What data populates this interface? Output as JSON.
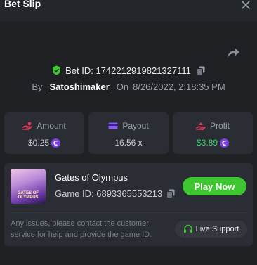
{
  "header": {
    "title": "Bet Slip",
    "close_icon": "close-icon"
  },
  "bet": {
    "id_label": "Bet ID: 1742212919821327111",
    "by_label": "By",
    "username": "Satoshimaker",
    "on_label": "On",
    "datetime": "8/26/2022, 2:18:35 PM"
  },
  "stats": {
    "amount": {
      "label": "Amount",
      "value": "$0.25",
      "icon": "amount-icon"
    },
    "payout": {
      "label": "Payout",
      "value": "16.56 x",
      "icon": "payout-icon"
    },
    "profit": {
      "label": "Profit",
      "value": "$3.89",
      "icon": "profit-icon"
    }
  },
  "game": {
    "thumb_text_line1": "GATES OF",
    "thumb_text_line2": "OLYMPUS",
    "name": "Gates of Olympus",
    "id_label": "Game ID: 6893365553213",
    "play_label": "Play Now"
  },
  "support": {
    "notice": "Any issues, please contact the customer service for help and provide the game ID.",
    "live_label": "Live Support"
  },
  "colors": {
    "background": "#23262b",
    "panel": "#1f2125",
    "card": "#2a2d33",
    "accent_green": "#3ec631",
    "profit_green": "#39d36b",
    "coin_purple": "#7b3fe4",
    "amount_red": "#e0385a"
  }
}
